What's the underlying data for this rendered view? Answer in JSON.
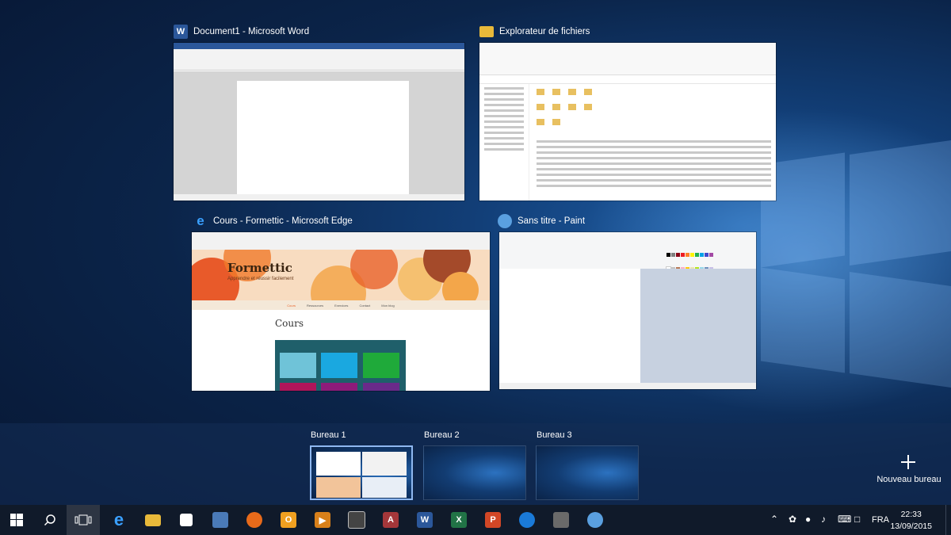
{
  "windows": [
    {
      "title": "Document1 - Microsoft Word",
      "icon": "word-icon",
      "color": "#2b579a"
    },
    {
      "title": "Explorateur de fichiers",
      "icon": "folder-icon",
      "color": "#e8b93a"
    },
    {
      "title": "Cours - Formettic - Microsoft Edge",
      "icon": "edge-icon",
      "color": "#1e7fd8"
    },
    {
      "title": "Sans titre - Paint",
      "icon": "paint-icon",
      "color": "#5aa0e0"
    }
  ],
  "edge_page": {
    "site": "Formettic",
    "tagline": "Apprendre et réussir facilement",
    "heading": "Cours",
    "menu": [
      "Cours",
      "Ressources",
      "Exercices",
      "Contact",
      "Mon blog"
    ]
  },
  "desktops": [
    {
      "label": "Bureau 1",
      "active": true
    },
    {
      "label": "Bureau 2",
      "active": false
    },
    {
      "label": "Bureau 3",
      "active": false
    }
  ],
  "new_desktop_label": "Nouveau bureau",
  "taskbar": {
    "apps": [
      "start-icon",
      "search-icon",
      "task-view-icon",
      "edge-icon",
      "file-explorer-icon",
      "store-icon",
      "photos-icon",
      "firefox-icon",
      "outlook-icon",
      "media-player-icon",
      "calculator-icon",
      "access-icon",
      "word-icon",
      "excel-icon",
      "powerpoint-icon",
      "sketch-icon",
      "drawing-icon",
      "paint-icon"
    ]
  },
  "tray": {
    "language": "FRA",
    "time": "22:33",
    "date": "13/09/2015"
  }
}
